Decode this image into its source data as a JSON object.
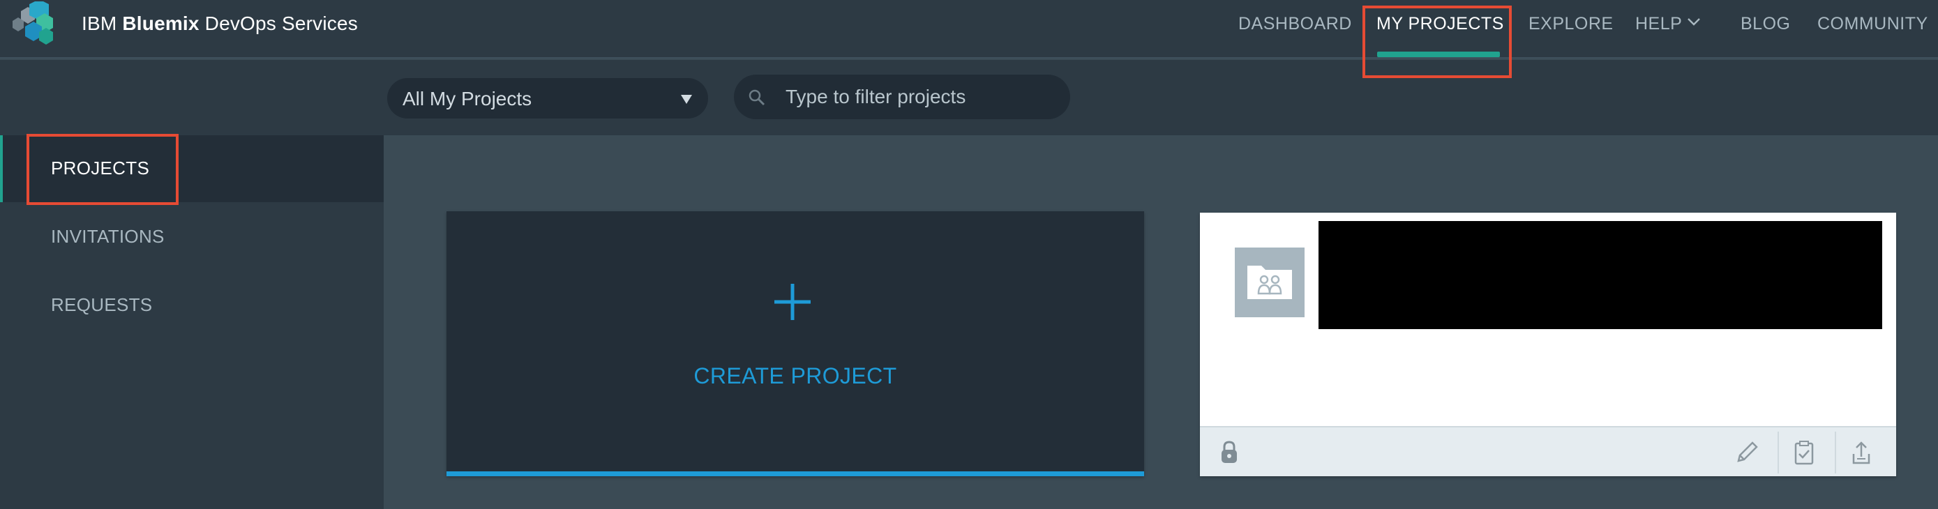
{
  "header": {
    "brand_prefix": "IBM ",
    "brand_bold": "Bluemix",
    "brand_suffix": " DevOps Services",
    "logo_icon": "bluemix-hexagon-logo",
    "nav": [
      {
        "label": "DASHBOARD",
        "active": false
      },
      {
        "label": "MY PROJECTS",
        "active": true
      },
      {
        "label": "EXPLORE",
        "active": false
      },
      {
        "label": "HELP",
        "active": false,
        "icon": "chevron-down-icon"
      },
      {
        "label": "BLOG",
        "active": false
      },
      {
        "label": "COMMUNITY",
        "active": false
      }
    ]
  },
  "filter": {
    "select_value": "All My Projects",
    "search_placeholder": "Type to filter projects"
  },
  "sidebar": {
    "items": [
      {
        "label": "PROJECTS",
        "active": true
      },
      {
        "label": "INVITATIONS",
        "active": false
      },
      {
        "label": "REQUESTS",
        "active": false
      }
    ]
  },
  "main": {
    "create_label": "CREATE PROJECT",
    "create_icon": "plus-icon",
    "project_card": {
      "thumbnail_icon": "shared-folder-icon",
      "footer_icons": [
        "lock-icon",
        "edit-pencil-icon",
        "clipboard-check-icon",
        "share-upload-icon"
      ]
    }
  },
  "colors": {
    "header_bg": "#2d3a44",
    "content_bg": "#3b4b55",
    "accent_teal": "#21a38f",
    "accent_blue": "#1e9bd7",
    "annotation_red": "#e64b34"
  }
}
